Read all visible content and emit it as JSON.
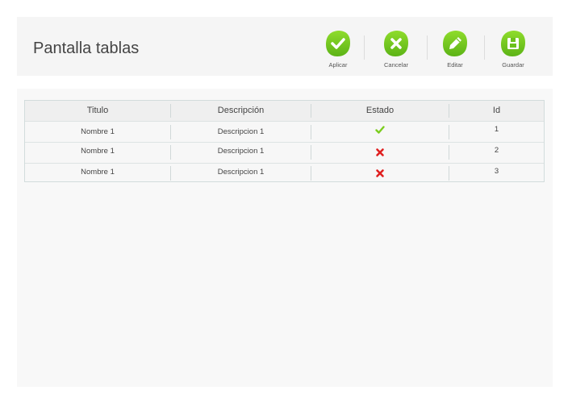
{
  "header": {
    "title": "Pantalla tablas",
    "toolbar": [
      {
        "label": "Aplicar",
        "icon": "check-icon"
      },
      {
        "label": "Cancelar",
        "icon": "close-icon"
      },
      {
        "label": "Editar",
        "icon": "pencil-icon"
      },
      {
        "label": "Guardar",
        "icon": "save-icon"
      }
    ]
  },
  "colors": {
    "accent_green": "#7ccd1f",
    "status_ok": "#7ccd1f",
    "status_error": "#e02020"
  },
  "table": {
    "columns": [
      "Titulo",
      "Descripción",
      "Estado",
      "Id"
    ],
    "rows": [
      {
        "titulo": "Nombre 1",
        "descripcion": "Descripcion 1",
        "estado": "check-icon",
        "id": "1"
      },
      {
        "titulo": "Nombre 1",
        "descripcion": "Descripcion 1",
        "estado": "cross-icon",
        "id": "2"
      },
      {
        "titulo": "Nombre 1",
        "descripcion": "Descripcion 1",
        "estado": "cross-icon",
        "id": "3"
      }
    ]
  }
}
